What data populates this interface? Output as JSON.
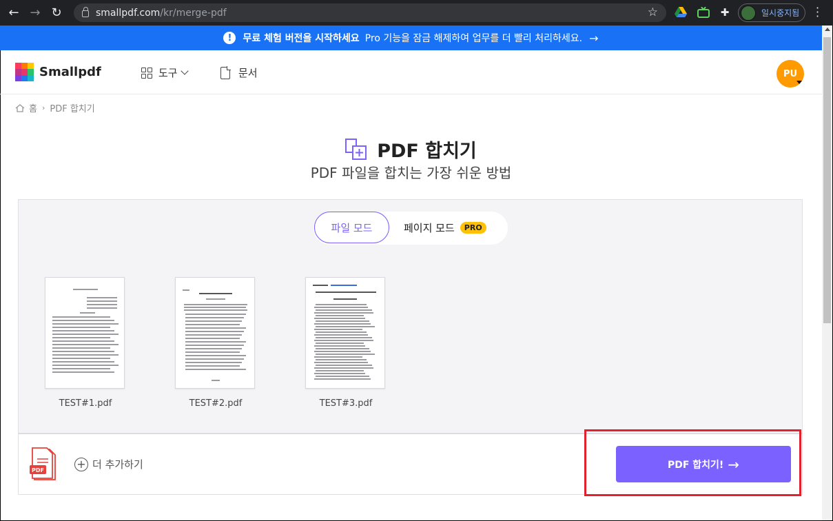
{
  "browser": {
    "url_host": "smallpdf.com",
    "url_path": "/kr/merge-pdf",
    "profile_name": "일시중지됨"
  },
  "banner": {
    "bold_text": "무료 체험 버전을 시작하세요",
    "text": "Pro 기능을 잠금 해제하여 업무를 더 빨리 처리하세요.",
    "arrow": "→"
  },
  "header": {
    "logo_text": "Smallpdf",
    "nav_tools": "도구",
    "nav_docs": "문서",
    "avatar_initials": "PU"
  },
  "breadcrumb": {
    "home": "홈",
    "separator": "›",
    "current": "PDF 합치기"
  },
  "main": {
    "title": "PDF 합치기",
    "subtitle": "PDF 파일을 합치는 가장 쉬운 방법"
  },
  "mode_switch": {
    "file_mode": "파일 모드",
    "page_mode": "페이지 모드",
    "pro_badge": "PRO"
  },
  "files": [
    {
      "name": "TEST#1.pdf"
    },
    {
      "name": "TEST#2.pdf"
    },
    {
      "name": "TEST#3.pdf"
    }
  ],
  "bottom_bar": {
    "pdf_icon_label": "PDF",
    "add_more": "더 추가하기",
    "merge_button": "PDF 합치기!",
    "merge_arrow": "→"
  },
  "colors": {
    "accent": "#7b61ff",
    "banner": "#1972f5",
    "avatar": "#ff9a00",
    "pro_badge": "#ffc107",
    "highlight": "#e0222d"
  }
}
